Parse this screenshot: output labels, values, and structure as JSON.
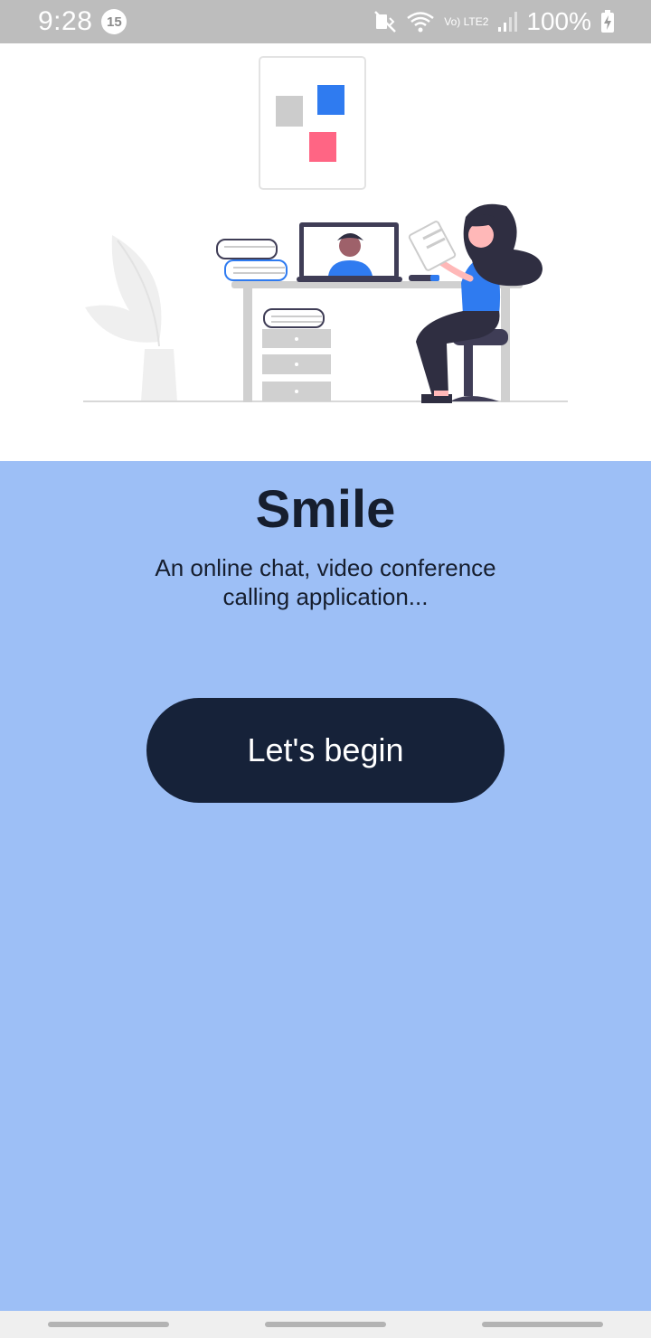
{
  "status_bar": {
    "time": "9:28",
    "notification_count": "15",
    "network_label": "Vo) LTE2",
    "battery": "100%"
  },
  "intro": {
    "title": "Smile",
    "subtitle": "An online chat, video conference calling application...",
    "button_label": "Let's begin"
  },
  "colors": {
    "status_bar_bg": "#bdbdbd",
    "panel_bg": "#9dbff6",
    "button_bg": "#162239",
    "title_text": "#161e2e",
    "accent_blue": "#2f7bf0",
    "accent_pink": "#ff6584"
  }
}
